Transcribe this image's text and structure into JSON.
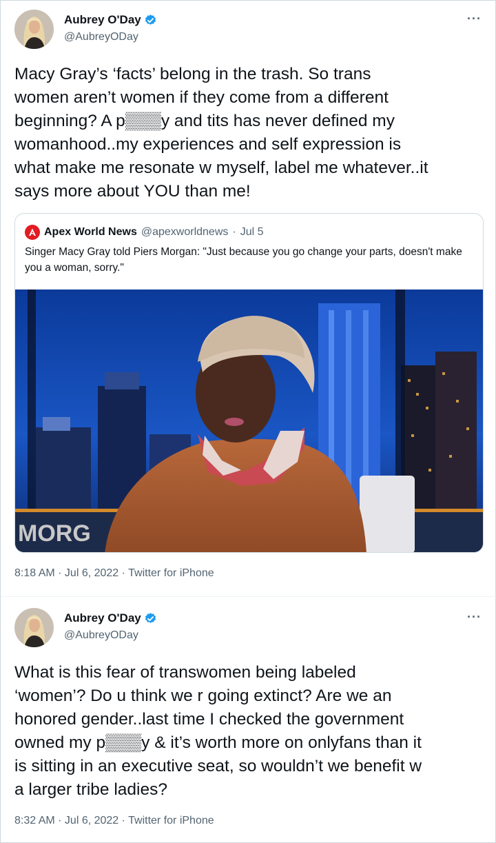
{
  "tweets": [
    {
      "author": {
        "name": "Aubrey O'Day",
        "handle": "@AubreyODay"
      },
      "more_icon": "···",
      "text": "Macy Gray’s ‘facts’ belong in the trash. So trans\nwomen aren’t women if they come from a different\nbeginning? A p▒▒▒y and tits has never defined my\nwomanhood..my experiences and self expression is\nwhat make me resonate w myself, label me whatever..it\nsays more about YOU than me!",
      "quote": {
        "name": "Apex World News",
        "handle": "@apexworldnews",
        "separator": "·",
        "date": "Jul 5",
        "text": "Singer Macy Gray told Piers Morgan: \"Just because you go change your parts, doesn't make you a woman, sorry.\"",
        "media_overlay_text": "MORG"
      },
      "timestamp": "8:18 AM · Jul 6, 2022 · Twitter for iPhone"
    },
    {
      "author": {
        "name": "Aubrey O'Day",
        "handle": "@AubreyODay"
      },
      "more_icon": "···",
      "text": "What is this fear of transwomen being labeled\n‘women’? Do u think we r going extinct? Are we an\nhonored gender..last time I checked the government\nowned my p▒▒▒y & it’s worth more on onlyfans than it\nis sitting in an executive seat, so wouldn’t we benefit w\na larger tribe ladies?",
      "timestamp": "8:32 AM · Jul 6, 2022 · Twitter for iPhone"
    }
  ],
  "colors": {
    "verified": "#1d9bf0",
    "secondary_text": "#536471",
    "quote_logo": "#e31c23"
  }
}
